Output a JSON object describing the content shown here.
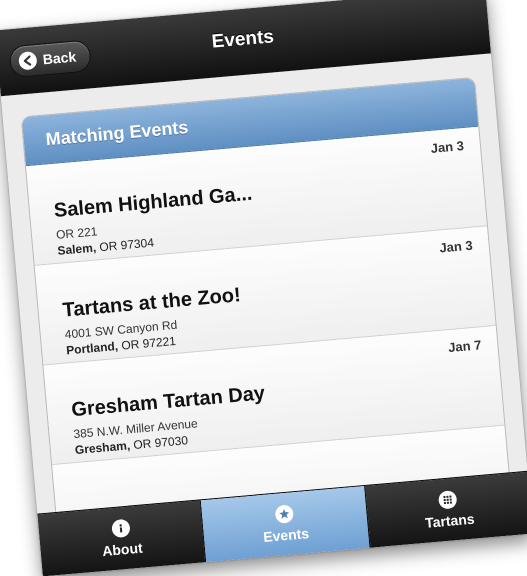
{
  "header": {
    "title": "Events",
    "back_label": "Back"
  },
  "list": {
    "heading": "Matching Events",
    "events": [
      {
        "date": "Jan 3",
        "title": "Salem Highland Ga...",
        "street": "OR 221",
        "city": "Salem,",
        "state_zip": " OR 97304"
      },
      {
        "date": "Jan 3",
        "title": "Tartans at the Zoo!",
        "street": "4001 SW Canyon Rd",
        "city": "Portland,",
        "state_zip": " OR 97221"
      },
      {
        "date": "Jan 7",
        "title": "Gresham Tartan Day",
        "street": "385 N.W. Miller Avenue",
        "city": "Gresham,",
        "state_zip": " OR 97030"
      }
    ]
  },
  "tabs": [
    {
      "label": "About",
      "icon": "info-icon"
    },
    {
      "label": "Events",
      "icon": "star-icon"
    },
    {
      "label": "Tartans",
      "icon": "grid-icon"
    }
  ],
  "colors": {
    "accent": "#6fa0d3",
    "header_dark": "#111111",
    "list_header": "#5f8fc2"
  }
}
